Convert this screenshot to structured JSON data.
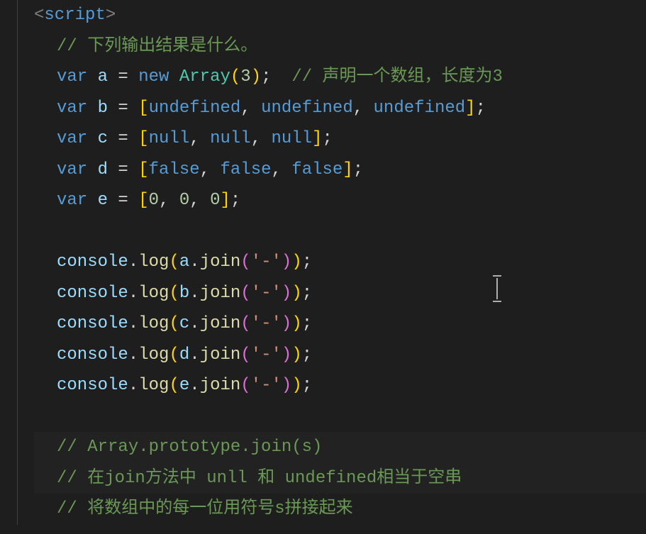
{
  "tag": {
    "open_bracket": "<",
    "name": "script",
    "close_bracket": ">"
  },
  "comments": {
    "c1": "// 下列输出结果是什么。",
    "c2": "// 声明一个数组，长度为3",
    "c3": "// Array.prototype.join(s)",
    "c4": "// 在join方法中 unll 和 undefined相当于空串",
    "c5": "// 将数组中的每一位用符号s拼接起来"
  },
  "kw": {
    "var": "var",
    "new": "new"
  },
  "vars": {
    "a": "a",
    "b": "b",
    "c": "c",
    "d": "d",
    "e": "e"
  },
  "cls": {
    "Array": "Array"
  },
  "const": {
    "undefined": "undefined",
    "null": "null",
    "false": "false"
  },
  "num": {
    "three": "3",
    "zero": "0"
  },
  "obj": {
    "console": "console"
  },
  "fn": {
    "log": "log",
    "join": "join"
  },
  "str": {
    "dash": "'-'"
  },
  "p": {
    "eq": " = ",
    "lp": "(",
    "rp": ")",
    "lb": "[",
    "rb": "]",
    "comma": ", ",
    "semi": ";",
    "dot": "."
  }
}
